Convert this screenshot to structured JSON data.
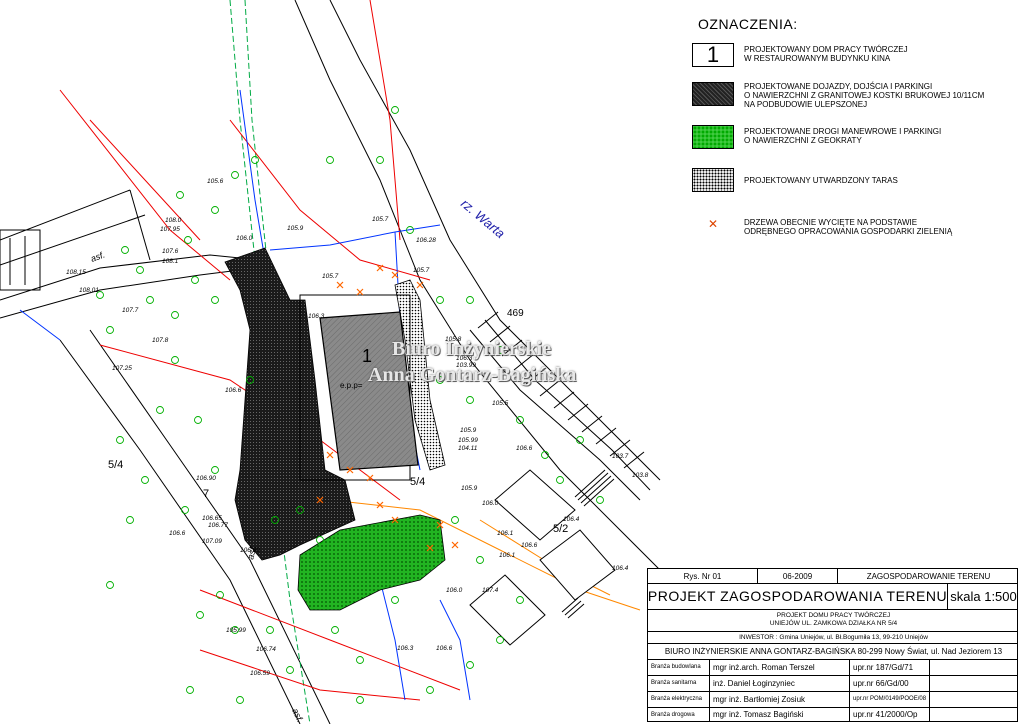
{
  "legend": {
    "title": "OZNACZENIA:",
    "items": [
      {
        "key": "item1",
        "swatch_label": "1",
        "text": "PROJEKTOWANY DOM PRACY TWÓRCZEJ\nW RESTAUROWANYM BUDYNKU KINA"
      },
      {
        "key": "item2",
        "swatch_label": "",
        "text": "PROJEKTOWANE DOJAZDY, DOJŚCIA I PARKINGI\nO NAWIERZCHNI Z GRANITOWEJ KOSTKI BRUKOWEJ 10/11cm\nNA PODBUDOWIE ULEPSZONEJ"
      },
      {
        "key": "item3",
        "swatch_label": "",
        "text": "PROJEKTOWANE DROGI MANEWROWE I PARKINGI\nO NAWIERZCHNI Z GEOKRATY"
      },
      {
        "key": "item4",
        "swatch_label": "",
        "text": "PROJEKTOWANY UTWARDZONY TARAS"
      },
      {
        "key": "item5",
        "swatch_label": "",
        "text": "DRZEWA OBECNIE WYCIĘTE NA PODSTAWIE\nODRĘBNEGO OPRACOWANIA GOSPODARKI ZIELENIĄ"
      }
    ]
  },
  "map": {
    "river_label": "rz. Warta",
    "parcel_469": "469",
    "parcel_5_4_left": "5/4",
    "parcel_5_4_mid": "5/4",
    "parcel_7": "7",
    "parcel_5_2": "5/2",
    "building_number": "1",
    "building_note": "e.p.p=",
    "asf_1": "asf.",
    "asf_2": "asf.",
    "asf_3": "asf.",
    "elevations": [
      {
        "id": "e1",
        "v": "105.6"
      },
      {
        "id": "e2",
        "v": "108.0"
      },
      {
        "id": "e3",
        "v": "107.95"
      },
      {
        "id": "e4",
        "v": "106.0"
      },
      {
        "id": "e5",
        "v": "105.9"
      },
      {
        "id": "e6",
        "v": "105.7"
      },
      {
        "id": "e7",
        "v": "105.7"
      },
      {
        "id": "e8",
        "v": "105.7"
      },
      {
        "id": "e9",
        "v": "106.3"
      },
      {
        "id": "e10",
        "v": "107.6"
      },
      {
        "id": "e11",
        "v": "108.1"
      },
      {
        "id": "e12",
        "v": "108.15"
      },
      {
        "id": "e13",
        "v": "108.01"
      },
      {
        "id": "e14",
        "v": "107.7"
      },
      {
        "id": "e15",
        "v": "107.8"
      },
      {
        "id": "e16",
        "v": "107.25"
      },
      {
        "id": "e17",
        "v": "106.6"
      },
      {
        "id": "e18",
        "v": "105.8"
      },
      {
        "id": "e19",
        "v": "105.5"
      },
      {
        "id": "e20",
        "v": "105.9"
      },
      {
        "id": "e21",
        "v": "106.6"
      },
      {
        "id": "e22",
        "v": "105.9"
      },
      {
        "id": "e23",
        "v": "103.7"
      },
      {
        "id": "e24",
        "v": "103.8"
      },
      {
        "id": "e25",
        "v": "106.0"
      },
      {
        "id": "e26",
        "v": "106.1"
      },
      {
        "id": "e27",
        "v": "106.4"
      },
      {
        "id": "e28",
        "v": "106.6"
      },
      {
        "id": "e29",
        "v": "106.1"
      },
      {
        "id": "e30",
        "v": "106.4"
      },
      {
        "id": "e31",
        "v": "106.90"
      },
      {
        "id": "e32",
        "v": "106.65"
      },
      {
        "id": "e33",
        "v": "106.77"
      },
      {
        "id": "e34",
        "v": "106.6"
      },
      {
        "id": "e35",
        "v": "107.09"
      },
      {
        "id": "e36",
        "v": "106.00"
      },
      {
        "id": "e37",
        "v": "106.0"
      },
      {
        "id": "e38",
        "v": "107.4"
      },
      {
        "id": "e39",
        "v": "106.3"
      },
      {
        "id": "e40",
        "v": "106.74"
      },
      {
        "id": "e41",
        "v": "105.99"
      },
      {
        "id": "e42",
        "v": "106.59"
      },
      {
        "id": "e43",
        "v": "106.6"
      },
      {
        "id": "e44",
        "v": "105.99"
      },
      {
        "id": "e45",
        "v": "104.11"
      },
      {
        "id": "e46",
        "v": "106.3"
      },
      {
        "id": "e47",
        "v": "103.99"
      },
      {
        "id": "e48",
        "v": "106.28"
      }
    ]
  },
  "title_block": {
    "ref": "Rys. Nr 01",
    "date": "06-2009",
    "sheet": "ZAGOSPODAROWANIE TERENU",
    "main_title": "PROJEKT  ZAGOSPODAROWANIA  TERENU",
    "scale": "skala  1:500",
    "project_line1": "PROJEKT DOMU PRACY TWÓRCZEJ",
    "project_line2": "UNIEJÓW UL. ZAMKOWA DZIAŁKA NR 5/4",
    "investor": "INWESTOR : Gmina Uniejów, ul. Bł.Bogumiła 13, 99-210 Uniejów",
    "office": "BIURO INŻYNIERSKIE ANNA GONTARZ-BAGIŃSKA 80-299 Nowy Świat, ul. Nad Jeziorem 13",
    "signatures": [
      {
        "branch": "Branża budowlana",
        "person": "mgr inż.arch. Roman Terszel",
        "license": "upr.nr 187/Gd/71"
      },
      {
        "branch": "Branża sanitarna",
        "person": "inż. Daniel Łoginzyniec",
        "license": "upr.nr 66/Gd/00"
      },
      {
        "branch": "Branża elektryczna",
        "person": "mgr inż. Bartłomiej Zosiuk",
        "license": "upr.nr POM/0149/POOE/08"
      },
      {
        "branch": "Branża drogowa",
        "person": "mgr inż. Tomasz Bagiński",
        "license": "upr.nr 41/2000/Op"
      }
    ]
  },
  "watermark": {
    "line1": "Biuro Inżynierskie",
    "line2": "Anna Gontarz-Bagińska"
  }
}
